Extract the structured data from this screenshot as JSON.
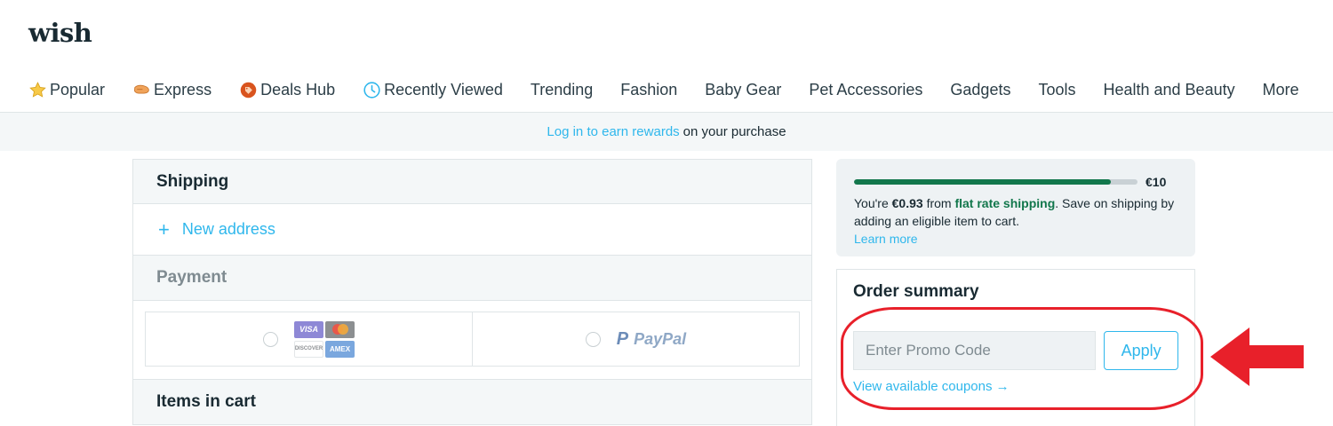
{
  "brand": {
    "logo": "wish"
  },
  "nav": {
    "items": [
      {
        "label": "Popular",
        "icon": "star-icon"
      },
      {
        "label": "Express",
        "icon": "express-icon"
      },
      {
        "label": "Deals Hub",
        "icon": "deals-tag-icon"
      },
      {
        "label": "Recently Viewed",
        "icon": "clock-icon"
      },
      {
        "label": "Trending"
      },
      {
        "label": "Fashion"
      },
      {
        "label": "Baby Gear"
      },
      {
        "label": "Pet Accessories"
      },
      {
        "label": "Gadgets"
      },
      {
        "label": "Tools"
      },
      {
        "label": "Health and Beauty"
      },
      {
        "label": "More"
      }
    ]
  },
  "rewards": {
    "link": "Log in to earn rewards",
    "text": "on your purchase"
  },
  "shipping": {
    "title": "Shipping",
    "new_address": "New address"
  },
  "payment": {
    "title": "Payment",
    "cards": {
      "visa": "VISA",
      "discover": "DISCOVER",
      "amex": "AMEX"
    },
    "paypal": "PayPal"
  },
  "items": {
    "title": "Items in cart"
  },
  "shipping_promo": {
    "progress_fraction": 0.907,
    "target": "€10",
    "text_pre": "You're ",
    "amount": "€0.93",
    "text_mid": " from ",
    "flat_rate": "flat rate shipping",
    "text_post": ". Save on shipping by adding an eligible item to cart.",
    "learn_more": "Learn more"
  },
  "order_summary": {
    "title": "Order summary",
    "promo_placeholder": "Enter Promo Code",
    "apply": "Apply",
    "coupons": "View available coupons →"
  },
  "colors": {
    "accent": "#2fb7ec",
    "green": "#12774c",
    "annotation_red": "#e8202a"
  }
}
